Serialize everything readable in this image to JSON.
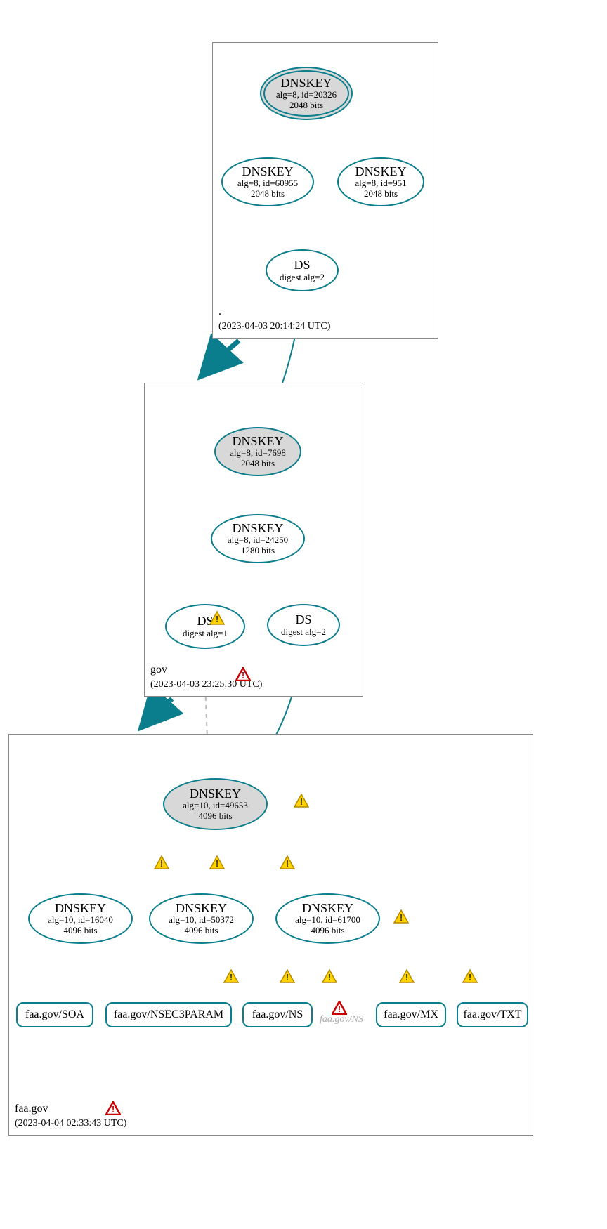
{
  "zones": {
    "root": {
      "label": ".",
      "timestamp": "(2023-04-03 20:14:24 UTC)"
    },
    "gov": {
      "label": "gov",
      "timestamp": "(2023-04-03 23:25:30 UTC)"
    },
    "faa": {
      "label": "faa.gov",
      "timestamp": "(2023-04-04 02:33:43 UTC)"
    }
  },
  "nodes": {
    "root_ksk": {
      "hdr": "DNSKEY",
      "l1": "alg=8, id=20326",
      "l2": "2048 bits"
    },
    "root_zsk1": {
      "hdr": "DNSKEY",
      "l1": "alg=8, id=60955",
      "l2": "2048 bits"
    },
    "root_zsk2": {
      "hdr": "DNSKEY",
      "l1": "alg=8, id=951",
      "l2": "2048 bits"
    },
    "root_ds": {
      "hdr": "DS",
      "l1": "digest alg=2",
      "l2": ""
    },
    "gov_ksk": {
      "hdr": "DNSKEY",
      "l1": "alg=8, id=7698",
      "l2": "2048 bits"
    },
    "gov_zsk": {
      "hdr": "DNSKEY",
      "l1": "alg=8, id=24250",
      "l2": "1280 bits"
    },
    "gov_ds1": {
      "hdr": "DS",
      "l1": "digest alg=1",
      "l2": ""
    },
    "gov_ds2": {
      "hdr": "DS",
      "l1": "digest alg=2",
      "l2": ""
    },
    "faa_ksk": {
      "hdr": "DNSKEY",
      "l1": "alg=10, id=49653",
      "l2": "4096 bits"
    },
    "faa_k1": {
      "hdr": "DNSKEY",
      "l1": "alg=10, id=16040",
      "l2": "4096 bits"
    },
    "faa_k2": {
      "hdr": "DNSKEY",
      "l1": "alg=10, id=50372",
      "l2": "4096 bits"
    },
    "faa_k3": {
      "hdr": "DNSKEY",
      "l1": "alg=10, id=61700",
      "l2": "4096 bits"
    }
  },
  "rrsets": {
    "soa": "faa.gov/SOA",
    "nsec3": "faa.gov/NSEC3PARAM",
    "ns": "faa.gov/NS",
    "mx": "faa.gov/MX",
    "txt": "faa.gov/TXT"
  },
  "ghost_ns": "faa.gov/NS",
  "chart_data": {
    "type": "graph",
    "description": "DNSSEC authentication chain (DNSViz-style) for faa.gov",
    "zones": [
      {
        "name": ".",
        "timestamp": "2023-04-03 20:14:24 UTC",
        "keys": [
          {
            "role": "KSK",
            "alg": 8,
            "id": 20326,
            "bits": 2048,
            "self_sig": true
          },
          {
            "role": "ZSK",
            "alg": 8,
            "id": 60955,
            "bits": 2048
          },
          {
            "role": "ZSK",
            "alg": 8,
            "id": 951,
            "bits": 2048
          }
        ],
        "ds_for_child": [
          {
            "digest_alg": 2
          }
        ]
      },
      {
        "name": "gov",
        "timestamp": "2023-04-03 23:25:30 UTC",
        "zone_status": "error",
        "keys": [
          {
            "role": "KSK",
            "alg": 8,
            "id": 7698,
            "bits": 2048,
            "self_sig": true
          },
          {
            "role": "ZSK",
            "alg": 8,
            "id": 24250,
            "bits": 1280
          }
        ],
        "ds_for_child": [
          {
            "digest_alg": 1,
            "status": "warning"
          },
          {
            "digest_alg": 2
          }
        ]
      },
      {
        "name": "faa.gov",
        "timestamp": "2023-04-04 02:33:43 UTC",
        "zone_status": "error",
        "keys": [
          {
            "role": "KSK",
            "alg": 10,
            "id": 49653,
            "bits": 4096,
            "self_sig": true,
            "self_sig_status": "warning"
          },
          {
            "role": "ZSK",
            "alg": 10,
            "id": 16040,
            "bits": 4096
          },
          {
            "role": "ZSK",
            "alg": 10,
            "id": 50372,
            "bits": 4096
          },
          {
            "role": "ZSK",
            "alg": 10,
            "id": 61700,
            "bits": 4096,
            "self_sig": true,
            "self_sig_status": "warning"
          }
        ],
        "signed_rrsets": [
          "faa.gov/SOA",
          "faa.gov/NSEC3PARAM",
          "faa.gov/NS",
          "faa.gov/MX",
          "faa.gov/TXT"
        ],
        "insecure_rrsets": [
          {
            "name": "faa.gov/NS",
            "status": "error"
          }
        ]
      }
    ],
    "edges": [
      {
        "from": "./DNSKEY/20326",
        "to": "./DNSKEY/20326",
        "kind": "self"
      },
      {
        "from": "./DNSKEY/20326",
        "to": "./DNSKEY/60955"
      },
      {
        "from": "./DNSKEY/20326",
        "to": "./DNSKEY/951"
      },
      {
        "from": "./DNSKEY/60955",
        "to": "./DS(gov,alg2)"
      },
      {
        "from": "./DS(gov,alg2)",
        "to": "gov/DNSKEY/7698"
      },
      {
        "from": "gov/DNSKEY/7698",
        "to": "gov/DNSKEY/7698",
        "kind": "self"
      },
      {
        "from": "gov/DNSKEY/7698",
        "to": "gov/DNSKEY/24250"
      },
      {
        "from": "gov/DNSKEY/24250",
        "to": "gov/DS(faa,alg1)",
        "status": "warning"
      },
      {
        "from": "gov/DNSKEY/24250",
        "to": "gov/DS(faa,alg2)"
      },
      {
        "from": "gov/DS(faa,alg1)",
        "to": "faa.gov/DNSKEY/49653",
        "style": "dashed-grey"
      },
      {
        "from": "gov/DS(faa,alg2)",
        "to": "faa.gov/DNSKEY/49653"
      },
      {
        "from": "faa.gov/DNSKEY/49653",
        "to": "faa.gov/DNSKEY/49653",
        "kind": "self",
        "status": "warning"
      },
      {
        "from": "faa.gov/DNSKEY/49653",
        "to": "faa.gov/DNSKEY/16040",
        "status": "warning"
      },
      {
        "from": "faa.gov/DNSKEY/49653",
        "to": "faa.gov/DNSKEY/50372",
        "status": "warning"
      },
      {
        "from": "faa.gov/DNSKEY/49653",
        "to": "faa.gov/DNSKEY/61700",
        "status": "warning"
      },
      {
        "from": "faa.gov/DNSKEY/61700",
        "to": "faa.gov/DNSKEY/61700",
        "kind": "self",
        "status": "warning"
      },
      {
        "from": "faa.gov/DNSKEY/61700",
        "to": "faa.gov/SOA",
        "status": "warning"
      },
      {
        "from": "faa.gov/DNSKEY/61700",
        "to": "faa.gov/NSEC3PARAM",
        "status": "warning"
      },
      {
        "from": "faa.gov/DNSKEY/61700",
        "to": "faa.gov/NS",
        "status": "warning"
      },
      {
        "from": "faa.gov/DNSKEY/61700",
        "to": "faa.gov/MX",
        "status": "warning"
      },
      {
        "from": "faa.gov/DNSKEY/61700",
        "to": "faa.gov/TXT",
        "status": "warning"
      }
    ]
  }
}
